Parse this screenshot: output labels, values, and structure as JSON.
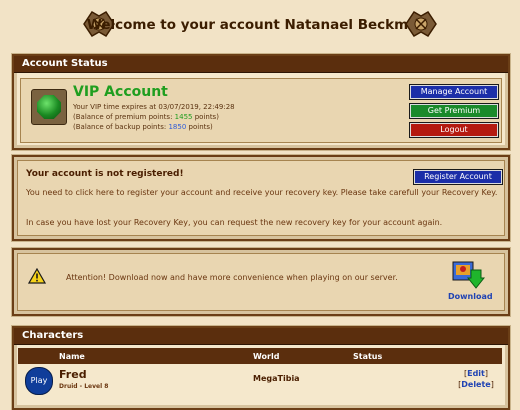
{
  "header": {
    "title": "Welcome to your account Natanael Beckman!"
  },
  "account_status": {
    "heading": "Account Status",
    "vip_title": "VIP Account",
    "expires_line": "Your VIP time expires at 03/07/2019, 22:49:28",
    "premium_prefix": "(Balance of premium points: ",
    "premium_value": "1455",
    "premium_suffix": " points)",
    "backup_prefix": "(Balance of backup points: ",
    "backup_value": "1850",
    "backup_suffix": " points)",
    "buttons": {
      "manage": "Manage Account",
      "premium": "Get Premium",
      "logout": "Logout"
    }
  },
  "register": {
    "title": "Your account is not registered!",
    "button": "Register Account",
    "text1": "You need to click here to register your account and receive your recovery key. Please take carefull your Recovery Key.",
    "text2": "In case you have lost your Recovery Key, you can request the new recovery key for your account again."
  },
  "download": {
    "text": "Attention! Download now and have more convenience when playing on our server.",
    "label": "Download"
  },
  "characters": {
    "heading": "Characters",
    "columns": [
      "Name",
      "World",
      "Status"
    ],
    "rows": [
      {
        "play": "Play",
        "name": "Fred",
        "sub": "Druid - Level 8",
        "world": "MegaTibia",
        "status": "",
        "edit": "Edit",
        "delete": "Delete"
      }
    ]
  },
  "colors": {
    "brown_header": "#5b2e0d",
    "background": "#f2e3c6",
    "vip_green": "#1f9e1f",
    "link_blue": "#2043b3"
  }
}
